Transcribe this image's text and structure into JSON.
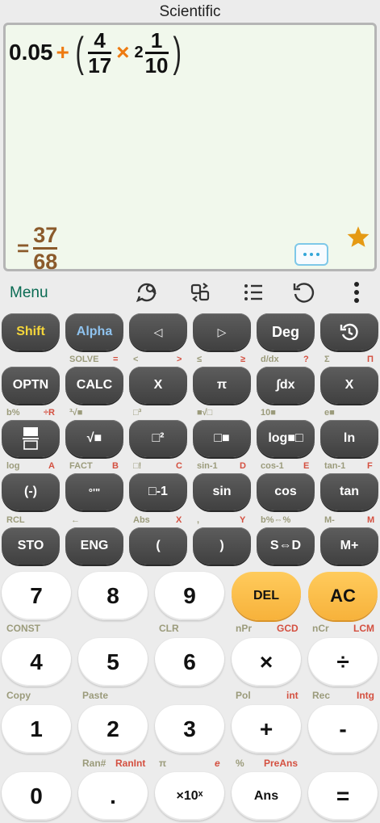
{
  "title": "Scientific",
  "expression": {
    "a": "0.05",
    "op1": "+",
    "f1_num": "4",
    "f1_den": "17",
    "op2": "×",
    "whole": "2",
    "f2_num": "1",
    "f2_den": "10"
  },
  "result": {
    "eq": "=",
    "num": "37",
    "den": "68"
  },
  "toolbar": {
    "menu": "Menu"
  },
  "keys": {
    "shift": "Shift",
    "alpha": "Alpha",
    "left": "◁",
    "right": "▷",
    "deg": "Deg",
    "optn": "OPTN",
    "calc": "CALC",
    "x1": "X",
    "pi": "π",
    "integ": "∫dx",
    "x2": "X",
    "frac": "",
    "sqrt": "√■",
    "sq": "□²",
    "pow": "□■",
    "log": "log■□",
    "ln": "ln",
    "neg": "(-)",
    "deg_min": "°'\"",
    "inv": "□-1",
    "sin": "sin",
    "cos": "cos",
    "tan": "tan",
    "sto": "STO",
    "eng": "ENG",
    "lpar": "(",
    "rpar": ")",
    "sd": "S⇔D",
    "mplus": "M+",
    "n7": "7",
    "n8": "8",
    "n9": "9",
    "del": "DEL",
    "ac": "AC",
    "n4": "4",
    "n5": "5",
    "n6": "6",
    "mul": "×",
    "div": "÷",
    "n1": "1",
    "n2": "2",
    "n3": "3",
    "plus": "+",
    "minus": "-",
    "n0": "0",
    "dot": ".",
    "exp": "×10ˣ",
    "ans": "Ans",
    "eq": "="
  },
  "labels": {
    "solve": "SOLVE",
    "solve_eq": "=",
    "lt": "<",
    "gt": ">",
    "le": "≤",
    "ge": "≥",
    "ddx": "d/dx",
    "q": "?",
    "sum": "Σ",
    "prod": "Π",
    "bpct": "b%",
    "divr": "÷R",
    "cbrt": "³√■",
    "cube": "□³",
    "xrt": "■√□",
    "ten": "10■",
    "epow": "e■",
    "log": "log",
    "A": "A",
    "fact": "FACT",
    "B": "B",
    "fac": "□!",
    "C": "C",
    "asin": "sin-1",
    "D": "D",
    "acos": "cos-1",
    "E": "E",
    "atan": "tan-1",
    "F": "F",
    "rcl": "RCL",
    "arrow": "←",
    "abs": "Abs",
    "X": "X",
    "comma": ",",
    "Y": "Y",
    "bpct2": "b%⇔%",
    "mminus": "M-",
    "M": "M",
    "const": "CONST",
    "clr": "CLR",
    "npr": "nPr",
    "gcd": "GCD",
    "ncr": "nCr",
    "lcm": "LCM",
    "copy": "Copy",
    "paste": "Paste",
    "pol": "Pol",
    "int": "int",
    "rec": "Rec",
    "intg": "Intg",
    "ran": "Ran#",
    "ranint": "RanInt",
    "pi": "π",
    "e": "e",
    "pct": "%",
    "preans": "PreAns"
  },
  "colors": {
    "accent": "#ee7a10",
    "result": "#8b5a2b",
    "shift": "#f5d63a",
    "alpha": "#8fc3ef",
    "menu": "#0a6b53"
  }
}
